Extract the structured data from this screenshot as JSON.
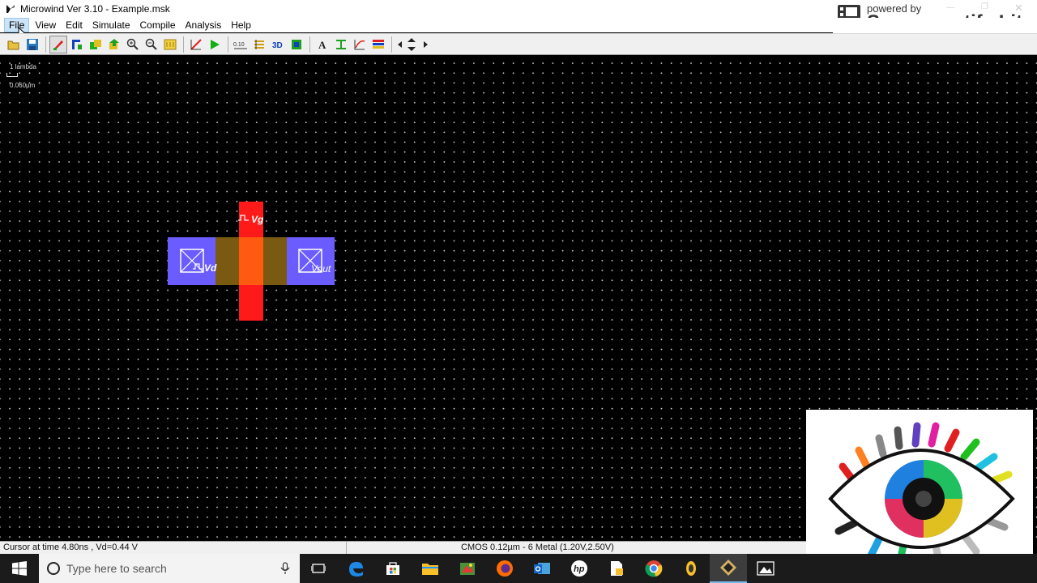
{
  "window": {
    "title": "Microwind Ver 3.10 - Example.msk"
  },
  "menu": [
    {
      "label": "File",
      "active": true
    },
    {
      "label": "View"
    },
    {
      "label": "Edit"
    },
    {
      "label": "Simulate"
    },
    {
      "label": "Compile"
    },
    {
      "label": "Analysis"
    },
    {
      "label": "Help"
    }
  ],
  "toolbar": {
    "icons": [
      "open-file-icon",
      "save-icon",
      "edit-pen-icon",
      "mos-generator-icon",
      "copy-icon",
      "move-icon",
      "zoom-in-icon",
      "zoom-out-icon",
      "view-all-icon",
      "measure-icon",
      "run-simulation-icon",
      "ruler-icon",
      "layer-visibility-icon",
      "3d-view-icon",
      "connect-icon",
      "text-icon",
      "cross-section-icon",
      "graph-icon",
      "palette-icon",
      "navigate-arrows-icon"
    ],
    "ruler_text": "0.10"
  },
  "canvas": {
    "scale_label_top": "1 lambda",
    "scale_label_bottom": "0.060µm",
    "labels": {
      "vg": "Vg",
      "vd": "Vd",
      "vout": "Vout"
    },
    "colors": {
      "background": "#000000",
      "diffusion": "#6a5cff",
      "polysilicon": "#ff1a1a",
      "gate_overlap": "#ff5a10",
      "channel": "#7a5a10"
    }
  },
  "status": {
    "left": "Cursor at  time 4.80ns , Vd=0.44 V",
    "right": "CMOS 0.12µm - 6 Metal (1.20V,2.50V)"
  },
  "taskbar": {
    "search_placeholder": "Type here to search",
    "apps": [
      "task-view-icon",
      "edge-icon",
      "store-icon",
      "file-explorer-icon",
      "paint-icon",
      "firefox-icon",
      "outlook-icon",
      "hp-icon",
      "file-pdf-icon",
      "chrome-icon",
      "media-player-icon",
      "microwind-icon",
      "photos-icon"
    ]
  },
  "watermark": {
    "small": "powered by",
    "big": "Screencastify Lite"
  }
}
